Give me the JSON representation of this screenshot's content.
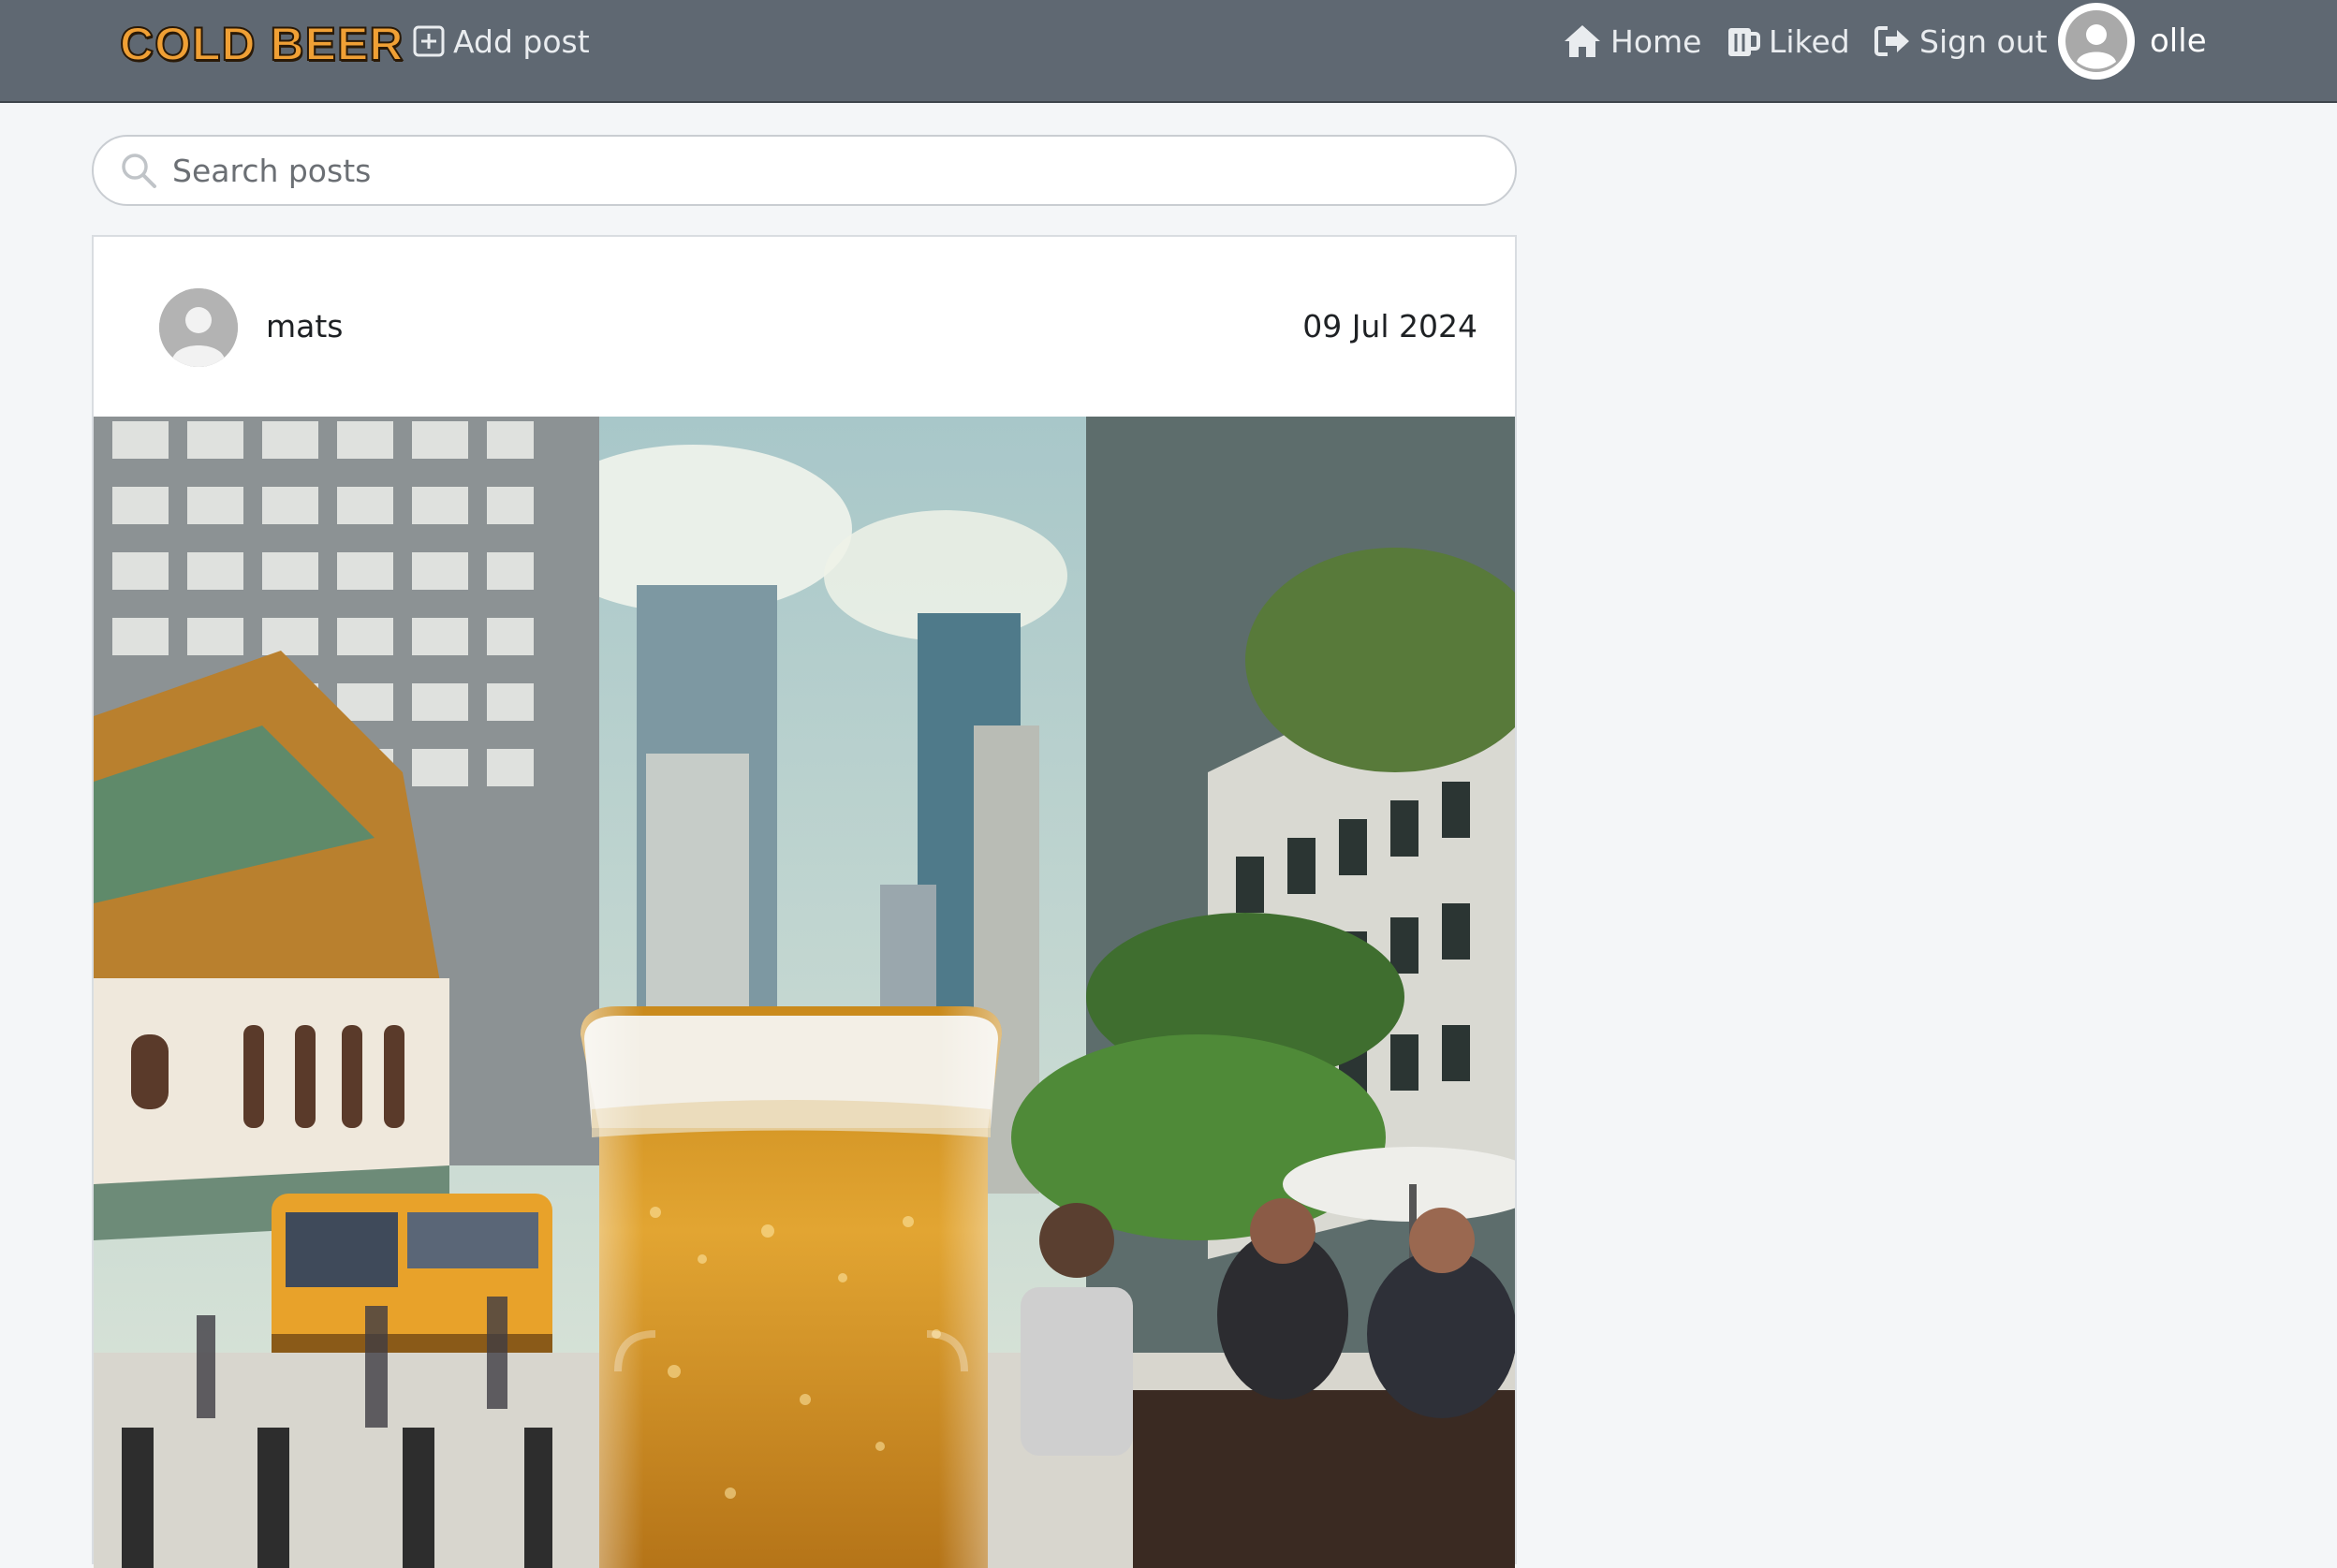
{
  "navbar": {
    "brand": "COLD BEER",
    "add_post": "Add post",
    "home": "Home",
    "liked": "Liked",
    "sign_out": "Sign out",
    "username": "olle"
  },
  "search": {
    "placeholder": "Search posts"
  },
  "post": {
    "author": "mats",
    "date": "09 Jul 2024"
  },
  "colors": {
    "navbar_bg": "#5f6872",
    "brand": "#f0a035",
    "page_bg": "#f4f6f8"
  }
}
